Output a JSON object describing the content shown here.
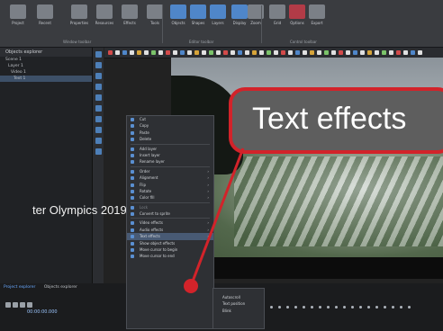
{
  "ribbon": {
    "buttons": [
      {
        "label": "Project",
        "icon": "project-icon"
      },
      {
        "label": "Recent",
        "icon": "recent-icon"
      },
      {
        "label": "Properties",
        "icon": "properties-icon"
      },
      {
        "label": "Resources",
        "icon": "resources-icon"
      },
      {
        "label": "Effects",
        "icon": "effects-icon"
      },
      {
        "label": "Tools",
        "icon": "tools-icon"
      },
      {
        "label": "Objects",
        "icon": "objects-icon"
      },
      {
        "label": "Shapes",
        "icon": "shapes-icon"
      },
      {
        "label": "Layers",
        "icon": "layers-icon"
      },
      {
        "label": "Display",
        "icon": "display-icon"
      },
      {
        "label": "Zoom",
        "icon": "zoom-icon"
      },
      {
        "label": "Grid",
        "icon": "grid-icon"
      },
      {
        "label": "Options",
        "icon": "options-icon"
      },
      {
        "label": "Export",
        "icon": "export-icon"
      }
    ],
    "groups": [
      "Window toolbar",
      "Editor toolbar",
      "Control toolbar"
    ]
  },
  "left_panel": {
    "title": "Objects explorer",
    "rows": [
      "Scene 1",
      "Layer 1",
      "Video 1",
      "Text 1"
    ]
  },
  "context_menu": {
    "items": [
      {
        "label": "Cut",
        "style": ""
      },
      {
        "label": "Copy",
        "style": ""
      },
      {
        "label": "Paste",
        "style": ""
      },
      {
        "label": "Delete",
        "style": ""
      },
      {
        "sep": true
      },
      {
        "label": "Add layer",
        "style": ""
      },
      {
        "label": "Insert layer",
        "style": ""
      },
      {
        "label": "Rename layer",
        "style": ""
      },
      {
        "sep": true
      },
      {
        "label": "Order",
        "style": "",
        "arrow": true
      },
      {
        "label": "Alignment",
        "style": "",
        "arrow": true
      },
      {
        "label": "Flip",
        "style": "",
        "arrow": true
      },
      {
        "label": "Rotate",
        "style": "",
        "arrow": true
      },
      {
        "label": "Color fill",
        "style": "",
        "arrow": true
      },
      {
        "sep": true
      },
      {
        "label": "Lock",
        "style": "dim"
      },
      {
        "label": "Convert to sprite",
        "style": ""
      },
      {
        "sep": true
      },
      {
        "label": "Video effects",
        "style": "",
        "arrow": true
      },
      {
        "label": "Audio effects",
        "style": "",
        "arrow": true
      },
      {
        "label": "Text effects",
        "style": "hl",
        "arrow": true
      },
      {
        "label": "Show object effects",
        "style": ""
      },
      {
        "label": "Move cursor to begin",
        "style": ""
      },
      {
        "label": "Move cursor to end",
        "style": ""
      }
    ]
  },
  "submenu": {
    "items": [
      "Autoscroll",
      "Text position",
      "Blink"
    ]
  },
  "preview": {
    "title_text": "ter Olympics 2019"
  },
  "bottom": {
    "tabs": [
      "Project explorer",
      "Objects explorer"
    ],
    "timecode": "00:00:00.000"
  },
  "callout": {
    "text": "Text effects",
    "border_color": "#d2232a",
    "bg_color": "#5e5e5e"
  }
}
